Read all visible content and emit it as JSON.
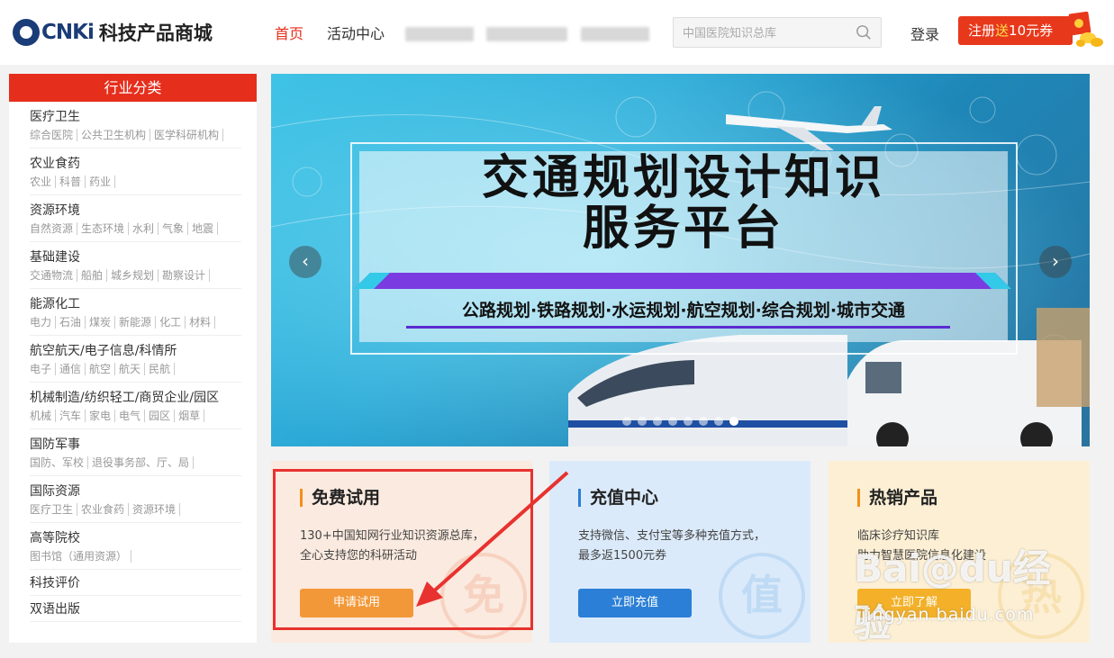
{
  "header": {
    "logo_text": "CNKi",
    "logo_sub": "科技产品商城",
    "nav": [
      {
        "label": "首页",
        "active": true
      },
      {
        "label": "活动中心",
        "active": false
      }
    ],
    "search_placeholder": "中国医院知识总库",
    "login_label": "登录",
    "register_prefix": "注册",
    "register_highlight": "送",
    "register_suffix": "10元券"
  },
  "sidebar": {
    "title": "行业分类",
    "categories": [
      {
        "name": "医疗卫生",
        "subs": [
          "综合医院",
          "公共卫生机构",
          "医学科研机构"
        ]
      },
      {
        "name": "农业食药",
        "subs": [
          "农业",
          "科普",
          "药业"
        ]
      },
      {
        "name": "资源环境",
        "subs": [
          "自然资源",
          "生态环境",
          "水利",
          "气象",
          "地震"
        ]
      },
      {
        "name": "基础建设",
        "subs": [
          "交通物流",
          "船舶",
          "城乡规划",
          "勘察设计"
        ]
      },
      {
        "name": "能源化工",
        "subs": [
          "电力",
          "石油",
          "煤炭",
          "新能源",
          "化工",
          "材料"
        ]
      },
      {
        "name": "航空航天/电子信息/科情所",
        "subs": [
          "电子",
          "通信",
          "航空",
          "航天",
          "民航"
        ]
      },
      {
        "name": "机械制造/纺织轻工/商贸企业/园区",
        "subs": [
          "机械",
          "汽车",
          "家电",
          "电气",
          "园区",
          "烟草"
        ]
      },
      {
        "name": "国防军事",
        "subs": [
          "国防、军校",
          "退役事务部、厅、局"
        ]
      },
      {
        "name": "国际资源",
        "subs": [
          "医疗卫生",
          "农业食药",
          "资源环境"
        ]
      },
      {
        "name": "高等院校",
        "subs": [
          "图书馆（通用资源）"
        ]
      },
      {
        "name": "科技评价",
        "subs": []
      },
      {
        "name": "双语出版",
        "subs": []
      }
    ]
  },
  "banner": {
    "title_line1": "交通规划设计知识",
    "title_line2": "服务平台",
    "subtitle": "公路规划·铁路规划·水运规划·航空规划·综合规划·城市交通",
    "prev_label": "‹",
    "next_label": "›",
    "dot_count": 8,
    "active_dot": 7
  },
  "cards": [
    {
      "title": "免费试用",
      "desc_line1": "130+中国知网行业知识资源总库，",
      "desc_line2": "全心支持您的科研活动",
      "button": "申请试用",
      "watermark": "免",
      "color": "#f39838"
    },
    {
      "title": "充值中心",
      "desc_line1": "支持微信、支付宝等多种充值方式，",
      "desc_line2": "最多返1500元券",
      "button": "立即充值",
      "watermark": "值",
      "color": "#2b7fd6"
    },
    {
      "title": "热销产品",
      "desc_line1": "临床诊疗知识库",
      "desc_line2": "助力智慧医院信息化建设",
      "button": "立即了解",
      "watermark": "热",
      "color": "#f3b028"
    }
  ],
  "overlay": {
    "watermark_brand": "Bai@du经验",
    "watermark_url": "jingyan.baidu.com"
  }
}
